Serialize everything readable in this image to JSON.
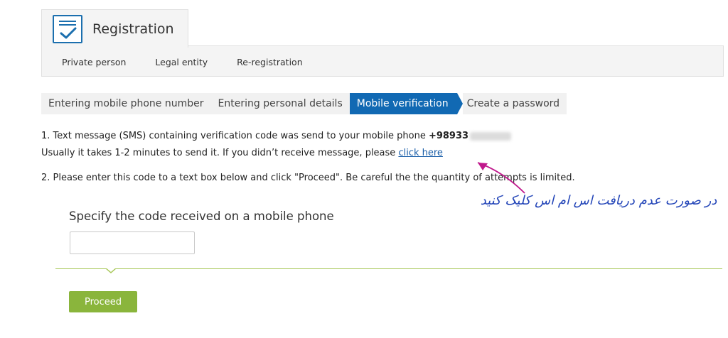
{
  "header": {
    "title": "Registration",
    "icon": "registration-form-icon",
    "accent_color": "#1b6fae",
    "subnav": [
      "Private person",
      "Legal entity",
      "Re-registration"
    ]
  },
  "steps": {
    "items": [
      "Entering mobile phone number",
      "Entering personal details",
      "Mobile verification",
      "Create a password"
    ],
    "active_index": 2,
    "active_color": "#1169b3"
  },
  "instructions": {
    "line1_prefix": "1. Text message (SMS) containing verification code was send to your mobile phone ",
    "phone_visible": "+98933",
    "line2_prefix": "Usually it takes 1-2 minutes to send it. If you didn’t receive message, please ",
    "resend_link": "click here",
    "line3": "2. Please enter this code to a text box below and click \"Proceed\". Be careful the the quantity of attempts is limited."
  },
  "annotation": {
    "text": "در صورت عدم دریافت اس ام اس کلیک کنید",
    "color": "#2345b8",
    "arrow_color": "#c0188c"
  },
  "form": {
    "code_label": "Specify the code received on a mobile phone",
    "code_value": "",
    "proceed_label": "Proceed",
    "button_color": "#8ab53c",
    "divider_color": "#a8c85a"
  }
}
